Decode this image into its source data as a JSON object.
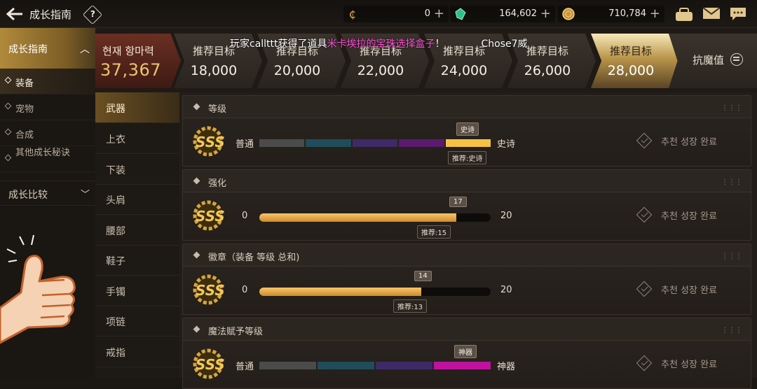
{
  "header": {
    "title": "成长指南",
    "help": "?",
    "currencies": [
      {
        "icon": "coin-c-icon",
        "value": "0"
      },
      {
        "icon": "green-gem-icon",
        "value": "164,602"
      },
      {
        "icon": "gold-coin-icon",
        "value": "710,784"
      }
    ],
    "plus": "+"
  },
  "sidebar": {
    "head": "成长指南",
    "items": [
      {
        "label": "装备"
      },
      {
        "label": "宠物"
      },
      {
        "label": "合成"
      },
      {
        "label": "其他成长秘诀"
      }
    ],
    "compare": "成长比较"
  },
  "strip": {
    "power_label": "현재 항마력",
    "power_value": "37,367",
    "targets": [
      {
        "label": "推荐目标",
        "value": "18,000"
      },
      {
        "label": "推荐目标",
        "value": "20,000"
      },
      {
        "label": "推荐目标",
        "value": "22,000"
      },
      {
        "label": "推荐目标",
        "value": "24,000"
      },
      {
        "label": "推荐目标",
        "value": "26,000"
      },
      {
        "label": "推荐目标",
        "value": "28,000"
      }
    ],
    "resist_label": "抗魔值"
  },
  "broadcast": {
    "prefix": "玩家callttt获得了道具",
    "item": "米卡埃拉的宝珠选择盒子",
    "suffix": "！",
    "who": "Chose7威"
  },
  "equipment": [
    "武器",
    "上衣",
    "下装",
    "头肩",
    "腰部",
    "鞋子",
    "手镯",
    "项链",
    "戒指"
  ],
  "panels": [
    {
      "title": "等级",
      "left": "普通",
      "right": "史诗",
      "top_tag": "史诗",
      "bottom_tag": "推荐:史诗",
      "segments": [
        "#4b4b4b",
        "#1f4d5a",
        "#3e2a66",
        "#5a1a6e",
        "#f5c242"
      ],
      "status": "추천 성장 완료"
    },
    {
      "title": "强化",
      "left": "0",
      "right": "20",
      "current": 17,
      "max": 20,
      "top_tag": "17",
      "bottom_tag": "推荐:15",
      "status": "추천 성장 완료"
    },
    {
      "title": "徽章（装备 等级 总和)",
      "left": "0",
      "right": "20",
      "current": 14,
      "max": 20,
      "top_tag": "14",
      "bottom_tag": "推荐:13",
      "status": "추천 성장 완료"
    },
    {
      "title": "魔法赋予等级",
      "left": "普通",
      "right": "神器",
      "top_tag": "神器",
      "segments": [
        "#4b4b4b",
        "#1f4d5a",
        "#3e2a66",
        "#c0129e"
      ],
      "status": "추천 성장 완료"
    }
  ]
}
